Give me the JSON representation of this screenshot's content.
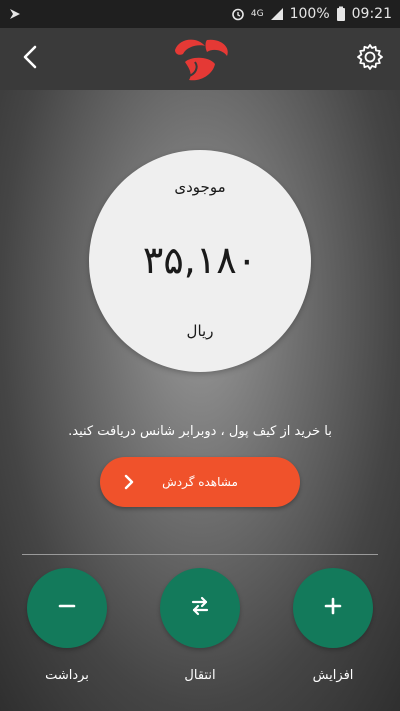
{
  "status_bar": {
    "network": "4G",
    "battery": "100%",
    "time": "09:21"
  },
  "header": {
    "back_icon": "chevron-left-icon",
    "settings_icon": "gear-icon",
    "logo": "brand-logo"
  },
  "balance": {
    "label": "موجودی",
    "amount": "۳۵,۱۸۰",
    "unit": "ریال"
  },
  "promo_text": "با خرید از کیف پول ، دوبرابر شانس دریافت کنید.",
  "history_button": {
    "label": "مشاهده گردش",
    "icon": "chevron-right-icon"
  },
  "actions": [
    {
      "label": "برداشت",
      "icon": "minus-icon"
    },
    {
      "label": "انتقال",
      "icon": "transfer-icon"
    },
    {
      "label": "افزایش",
      "icon": "plus-icon"
    }
  ],
  "colors": {
    "accent": "#f0522b",
    "action": "#137a5b",
    "logo": "#e53935"
  }
}
